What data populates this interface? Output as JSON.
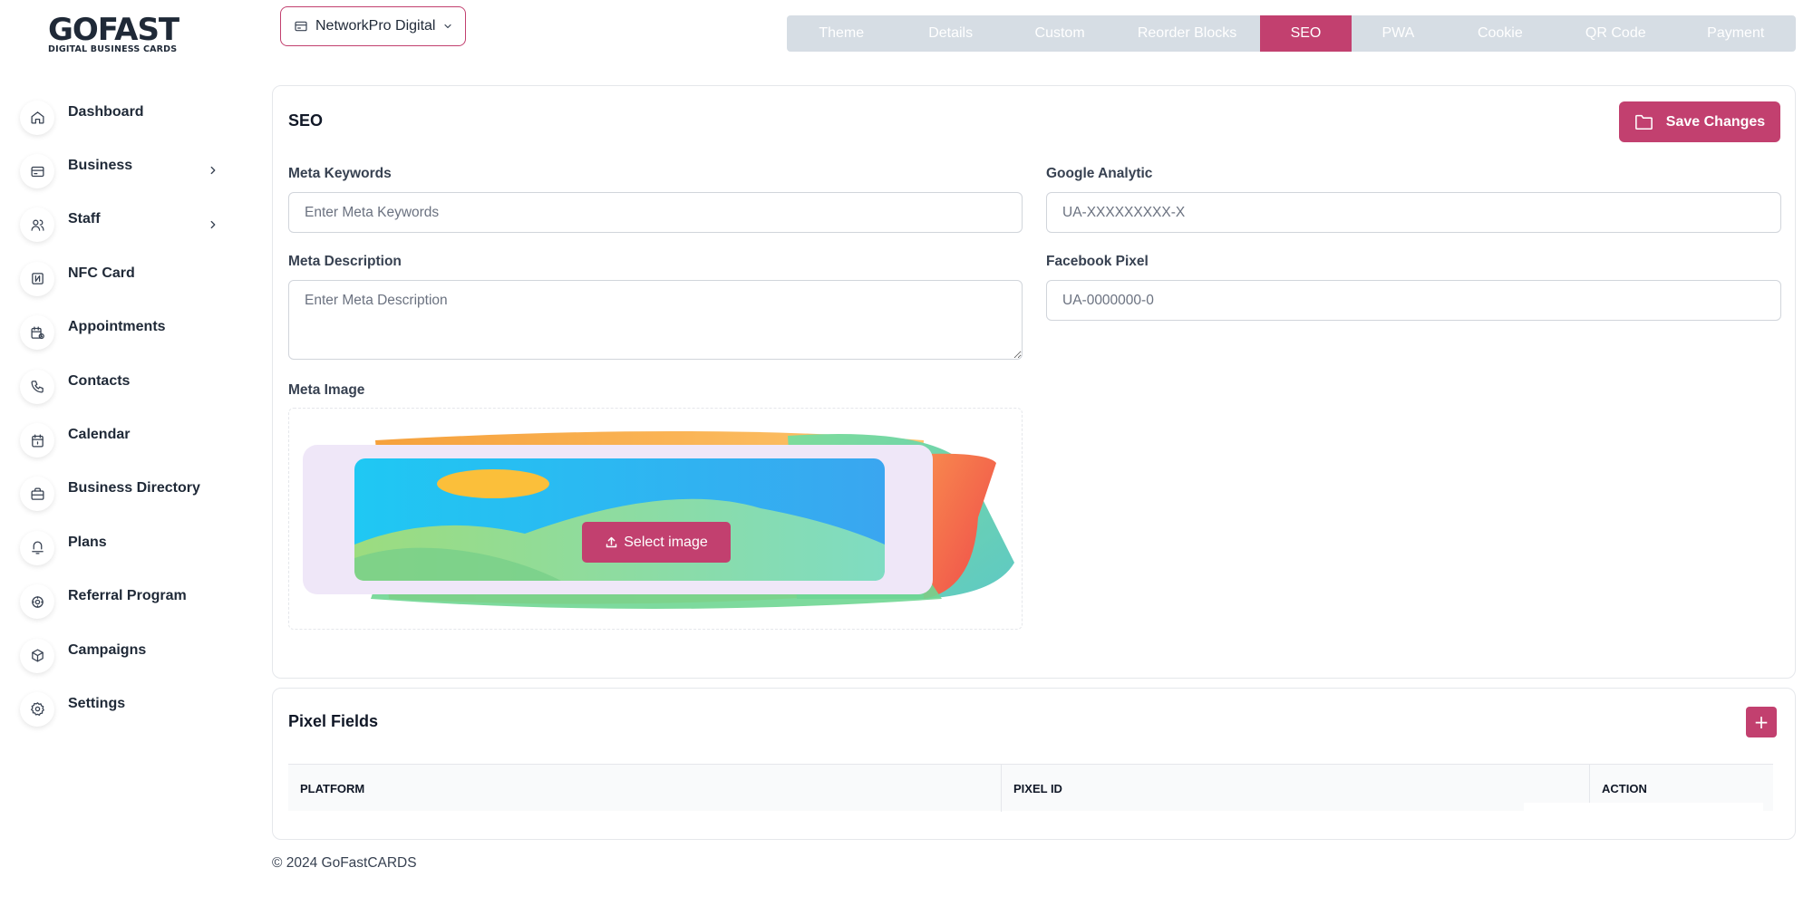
{
  "logo": {
    "main": "GOFAST",
    "sub": "DIGITAL BUSINESS CARDS"
  },
  "sidebar": {
    "items": [
      {
        "label": "Dashboard",
        "icon": "home-icon",
        "expandable": false
      },
      {
        "label": "Business",
        "icon": "card-icon",
        "expandable": true
      },
      {
        "label": "Staff",
        "icon": "users-icon",
        "expandable": true
      },
      {
        "label": "NFC Card",
        "icon": "nfc-icon",
        "expandable": false
      },
      {
        "label": "Appointments",
        "icon": "calendar-clock-icon",
        "expandable": false
      },
      {
        "label": "Contacts",
        "icon": "phone-icon",
        "expandable": false
      },
      {
        "label": "Calendar",
        "icon": "calendar-icon",
        "expandable": false
      },
      {
        "label": "Business Directory",
        "icon": "briefcase-icon",
        "expandable": false
      },
      {
        "label": "Plans",
        "icon": "award-icon",
        "expandable": false
      },
      {
        "label": "Referral Program",
        "icon": "referral-icon",
        "expandable": false
      },
      {
        "label": "Campaigns",
        "icon": "box-icon",
        "expandable": false
      },
      {
        "label": "Settings",
        "icon": "gear-icon",
        "expandable": false
      }
    ]
  },
  "business_select": {
    "value": "NetworkPro Digital"
  },
  "tabs": [
    {
      "label": "Theme",
      "active": false
    },
    {
      "label": "Details",
      "active": false
    },
    {
      "label": "Custom",
      "active": false
    },
    {
      "label": "Reorder Blocks",
      "active": false
    },
    {
      "label": "SEO",
      "active": true
    },
    {
      "label": "PWA",
      "active": false
    },
    {
      "label": "Cookie",
      "active": false
    },
    {
      "label": "QR Code",
      "active": false
    },
    {
      "label": "Payment",
      "active": false
    }
  ],
  "seo": {
    "title": "SEO",
    "save_label": "Save Changes",
    "meta_keywords": {
      "label": "Meta Keywords",
      "placeholder": "Enter Meta Keywords",
      "value": ""
    },
    "google_analytic": {
      "label": "Google Analytic",
      "placeholder": "UA-XXXXXXXXX-X",
      "value": ""
    },
    "meta_description": {
      "label": "Meta Description",
      "placeholder": "Enter Meta Description",
      "value": ""
    },
    "facebook_pixel": {
      "label": "Facebook Pixel",
      "placeholder": "UA-0000000-0",
      "value": ""
    },
    "meta_image": {
      "label": "Meta Image",
      "button_label": "Select image"
    }
  },
  "pixel_fields": {
    "title": "Pixel Fields",
    "add_label": "+",
    "columns": [
      "PLATFORM",
      "PIXEL ID",
      "ACTION"
    ]
  },
  "footer": {
    "text": "© 2024 GoFastCARDS"
  },
  "colors": {
    "accent": "#c2406f",
    "tabs_bg": "#d6dde4"
  }
}
